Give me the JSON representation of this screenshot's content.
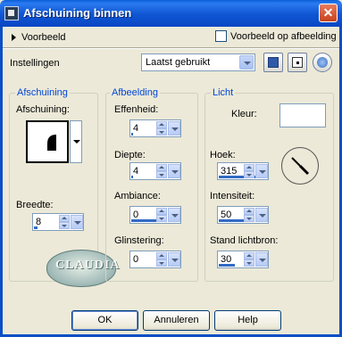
{
  "window": {
    "title": "Afschuining binnen",
    "close": "✕"
  },
  "preview": {
    "toggle_label": "Voorbeeld",
    "checkbox_label": "Voorbeeld op afbeelding"
  },
  "settings": {
    "label": "Instellingen",
    "preset_value": "Laatst gebruikt"
  },
  "bevel_group": {
    "title": "Afschuining",
    "shape_label": "Afschuining:",
    "width_label": "Breedte:",
    "width_value": "8",
    "width_progress": 0.15
  },
  "image_group": {
    "title": "Afbeelding",
    "smoothness_label": "Effenheid:",
    "smoothness_value": "4",
    "smoothness_progress": 0.04,
    "depth_label": "Diepte:",
    "depth_value": "4",
    "depth_progress": 0.04,
    "ambience_label": "Ambiance:",
    "ambience_value": "0",
    "ambience_progress": 0.5,
    "shininess_label": "Glinstering:",
    "shininess_value": "0",
    "shininess_progress": 0.0
  },
  "light_group": {
    "title": "Licht",
    "color_label": "Kleur:",
    "color": "#ffffff",
    "angle_label": "Hoek:",
    "angle_value": "315",
    "angle_progress": 0.875,
    "intensity_label": "Intensiteit:",
    "intensity_value": "50",
    "intensity_progress": 0.5,
    "elevation_label": "Stand lichtbron:",
    "elevation_value": "30",
    "elevation_progress": 0.33
  },
  "watermark": {
    "text": "CLAUDIA"
  },
  "buttons": {
    "ok": "OK",
    "cancel": "Annuleren",
    "help": "Help"
  },
  "colors": {
    "title_bar": "#0a5fd8",
    "dialog_bg": "#ece9d8",
    "group_title": "#0046d5",
    "slider_fill": "#316ac5"
  }
}
